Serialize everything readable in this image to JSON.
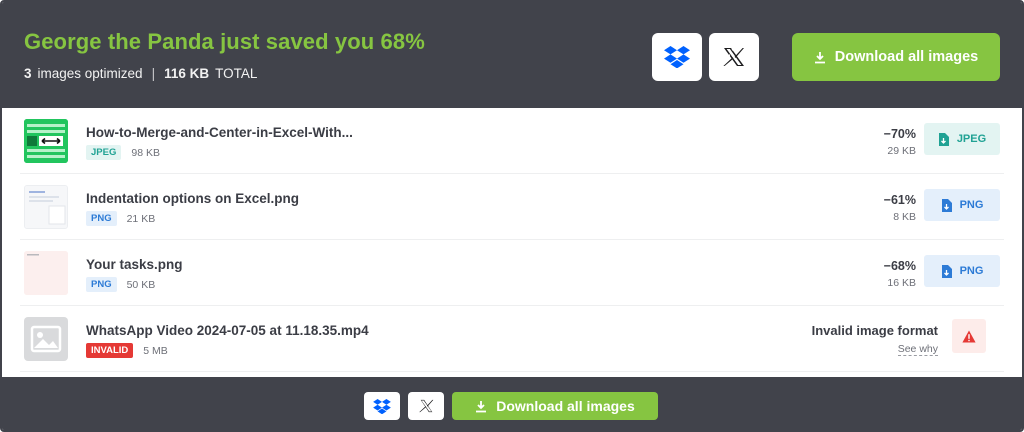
{
  "header": {
    "title": "George the Panda just saved you 68%",
    "count": "3",
    "count_label": "images optimized",
    "separator": "|",
    "total": "116 KB",
    "total_label": "TOTAL",
    "download_all": "Download all images",
    "share_icons": [
      "dropbox-icon",
      "x-icon"
    ]
  },
  "colors": {
    "header_bg": "#41434b",
    "accent_green": "#86c541",
    "jpeg": "#20a294",
    "png": "#2d7bd6",
    "invalid": "#e53935"
  },
  "files": [
    {
      "name": "How-to-Merge-and-Center-in-Excel-With...",
      "type": "JPEG",
      "orig_size": "98 KB",
      "saving": "−70%",
      "new_size": "29 KB",
      "download_label": "JPEG"
    },
    {
      "name": "Indentation options on Excel.png",
      "type": "PNG",
      "orig_size": "21 KB",
      "saving": "−61%",
      "new_size": "8 KB",
      "download_label": "PNG"
    },
    {
      "name": "Your tasks.png",
      "type": "PNG",
      "orig_size": "50 KB",
      "saving": "−68%",
      "new_size": "16 KB",
      "download_label": "PNG"
    },
    {
      "name": "WhatsApp Video 2024-07-05 at 11.18.35.mp4",
      "type": "INVALID",
      "orig_size": "5 MB",
      "error": "Invalid image format",
      "see_why": "See why"
    }
  ],
  "footer": {
    "download_all": "Download all images"
  }
}
